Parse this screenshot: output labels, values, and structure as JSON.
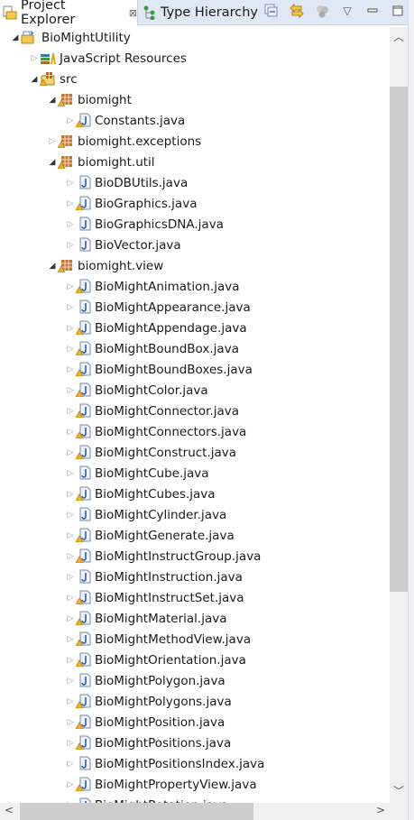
{
  "tabs": [
    {
      "label": "Project Explorer",
      "icon": "project-explorer-icon",
      "active": true
    },
    {
      "label": "Type Hierarchy",
      "icon": "type-hierarchy-icon",
      "active": false
    }
  ],
  "toolbar": [
    "collapse-all-icon",
    "link-with-editor-icon",
    "filters-icon",
    "view-menu-icon",
    "minimize-icon",
    "maximize-icon"
  ],
  "colors": {
    "warning": "#e8a317",
    "package": "#b5651d",
    "java": "#2f5fa6",
    "tabbar": "#dfe8f4"
  },
  "tree": [
    {
      "label": "BioMightUtility",
      "level": 0,
      "type": "project",
      "expanded": true
    },
    {
      "label": "JavaScript Resources",
      "level": 1,
      "type": "library",
      "expanded": false
    },
    {
      "label": "src",
      "level": 1,
      "type": "source-folder",
      "expanded": true,
      "warning": true
    },
    {
      "label": "biomight",
      "level": 2,
      "type": "package",
      "expanded": true,
      "warning": true
    },
    {
      "label": "Constants.java",
      "level": 3,
      "type": "java",
      "warning": true
    },
    {
      "label": "biomight.exceptions",
      "level": 2,
      "type": "package",
      "expanded": false,
      "warning": true
    },
    {
      "label": "biomight.util",
      "level": 2,
      "type": "package",
      "expanded": true,
      "warning": true
    },
    {
      "label": "BioDBUtils.java",
      "level": 3,
      "type": "java",
      "warning": false
    },
    {
      "label": "BioGraphics.java",
      "level": 3,
      "type": "java",
      "warning": true
    },
    {
      "label": "BioGraphicsDNA.java",
      "level": 3,
      "type": "java",
      "warning": false
    },
    {
      "label": "BioVector.java",
      "level": 3,
      "type": "java",
      "warning": false
    },
    {
      "label": "biomight.view",
      "level": 2,
      "type": "package",
      "expanded": true,
      "warning": true
    },
    {
      "label": "BioMightAnimation.java",
      "level": 3,
      "type": "java",
      "warning": true
    },
    {
      "label": "BioMightAppearance.java",
      "level": 3,
      "type": "java",
      "warning": false
    },
    {
      "label": "BioMightAppendage.java",
      "level": 3,
      "type": "java",
      "warning": true
    },
    {
      "label": "BioMightBoundBox.java",
      "level": 3,
      "type": "java",
      "warning": true
    },
    {
      "label": "BioMightBoundBoxes.java",
      "level": 3,
      "type": "java",
      "warning": true
    },
    {
      "label": "BioMightColor.java",
      "level": 3,
      "type": "java",
      "warning": true
    },
    {
      "label": "BioMightConnector.java",
      "level": 3,
      "type": "java",
      "warning": true
    },
    {
      "label": "BioMightConnectors.java",
      "level": 3,
      "type": "java",
      "warning": true
    },
    {
      "label": "BioMightConstruct.java",
      "level": 3,
      "type": "java",
      "warning": true
    },
    {
      "label": "BioMightCube.java",
      "level": 3,
      "type": "java",
      "warning": false
    },
    {
      "label": "BioMightCubes.java",
      "level": 3,
      "type": "java",
      "warning": true
    },
    {
      "label": "BioMightCylinder.java",
      "level": 3,
      "type": "java",
      "warning": false
    },
    {
      "label": "BioMightGenerate.java",
      "level": 3,
      "type": "java",
      "warning": true
    },
    {
      "label": "BioMightInstructGroup.java",
      "level": 3,
      "type": "java",
      "warning": true
    },
    {
      "label": "BioMightInstruction.java",
      "level": 3,
      "type": "java",
      "warning": false
    },
    {
      "label": "BioMightInstructSet.java",
      "level": 3,
      "type": "java",
      "warning": true
    },
    {
      "label": "BioMightMaterial.java",
      "level": 3,
      "type": "java",
      "warning": true
    },
    {
      "label": "BioMightMethodView.java",
      "level": 3,
      "type": "java",
      "warning": true
    },
    {
      "label": "BioMightOrientation.java",
      "level": 3,
      "type": "java",
      "warning": true
    },
    {
      "label": "BioMightPolygon.java",
      "level": 3,
      "type": "java",
      "warning": false
    },
    {
      "label": "BioMightPolygons.java",
      "level": 3,
      "type": "java",
      "warning": true
    },
    {
      "label": "BioMightPosition.java",
      "level": 3,
      "type": "java",
      "warning": true
    },
    {
      "label": "BioMightPositions.java",
      "level": 3,
      "type": "java",
      "warning": true
    },
    {
      "label": "BioMightPositionsIndex.java",
      "level": 3,
      "type": "java",
      "warning": false
    },
    {
      "label": "BioMightPropertyView.java",
      "level": 3,
      "type": "java",
      "warning": true
    },
    {
      "label": "BioMightRotation.java",
      "level": 3,
      "type": "java",
      "warning": true
    }
  ]
}
